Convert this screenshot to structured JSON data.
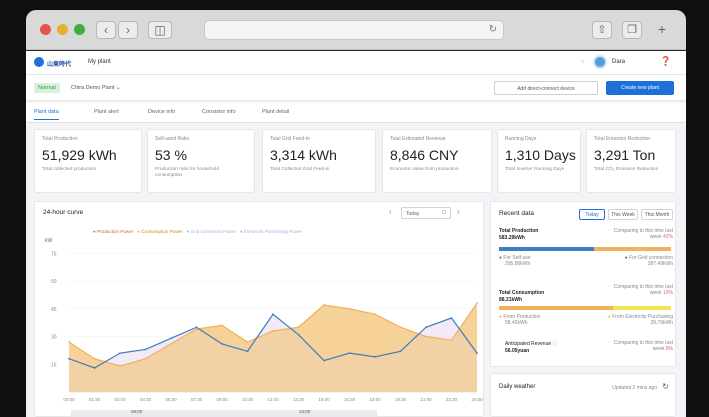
{
  "browser": {
    "colors": {
      "close": "#e5534b",
      "minimize": "#e8b030",
      "maximize": "#3fae3e"
    }
  },
  "header": {
    "logo_text": "山東時代",
    "plant_link": "My plant",
    "user_name": "Dara"
  },
  "subheader": {
    "status_badge": "Normal",
    "plant_name": "Chira Demo Plant",
    "add_device_button": "Add direct-connect device",
    "create_plant_button": "Create new plant"
  },
  "tabs": [
    "Plant data",
    "Plant alert",
    "Device info",
    "Consistor info",
    "Plant detail"
  ],
  "kpis": [
    {
      "label": "Total Production",
      "value": "51,929 kWh",
      "desc": "Total collected production"
    },
    {
      "label": "Self-used Ratio",
      "value": "53 %",
      "desc": "Production ratio for household consumption"
    },
    {
      "label": "Total Grid Feed-in",
      "value": "3,314 kWh",
      "desc": "Total Collected Grid Feed-in"
    },
    {
      "label": "Total Estimated Revenue",
      "value": "8,846 CNY",
      "desc": "Economic value from production"
    },
    {
      "label": "Running Days",
      "value": "1,310 Days",
      "desc": "Total Inverter Running Days"
    },
    {
      "label": "Total Emission Reduction",
      "value": "3,291 Ton",
      "desc": "Total CO₂ Emission Reduction"
    }
  ],
  "curve": {
    "title": "24-hour curve",
    "today_button": "Today",
    "unit_label": "kW",
    "legend": [
      "Production Power",
      "Consumption Power",
      "Grid connected Power",
      "Electricity Purchasing Power"
    ]
  },
  "chart_data": {
    "type": "area",
    "x": [
      "00:00",
      "01:30",
      "03:00",
      "04:30",
      "06:00",
      "07:30",
      "09:00",
      "10:30",
      "12:00",
      "13:30",
      "15:00",
      "16:30",
      "18:00",
      "19:30",
      "21:00",
      "22:30",
      "24:00"
    ],
    "series": [
      {
        "name": "Production Power",
        "color": "#3a7fc1",
        "values": [
          18,
          13,
          21,
          23,
          29,
          35,
          26,
          22,
          42,
          31,
          17,
          21,
          19,
          22,
          35,
          40,
          21
        ]
      },
      {
        "name": "Consumption Power",
        "color": "#f2b15a",
        "values": [
          27,
          18,
          14,
          18,
          26,
          34,
          36,
          27,
          33,
          35,
          47,
          45,
          42,
          35,
          30,
          28,
          48
        ]
      }
    ],
    "ylim": [
      0,
      80
    ],
    "yticks": [
      "75",
      "50",
      "45",
      "30",
      "15"
    ],
    "grid": true,
    "legend_position": "top"
  },
  "recent": {
    "title": "Recent data",
    "periods": [
      "Today",
      "This Week",
      "This Month"
    ],
    "production": {
      "label": "Total Production",
      "value": "583.29kWh",
      "compare": "Comparing to this time last week",
      "change": "42%"
    },
    "prod_items": [
      {
        "label": "For Self-use",
        "value": "295.80kWh"
      },
      {
        "label": "For Grid connection",
        "value": "287.49kWh"
      }
    ],
    "consumption": {
      "label": "Total Consumption",
      "value": "88.21kWh",
      "compare": "Comparing to this time last week",
      "change": "10%"
    },
    "cons_items": [
      {
        "label": "From Production",
        "value": "58.42kWh"
      },
      {
        "label": "From Electricity Purchasing",
        "value": "29.79kWh"
      }
    ],
    "revenue": {
      "label": "Anticipated Revenue",
      "value": "56.05yuan",
      "compare": "Comparing to this time last week",
      "change": "9%"
    }
  },
  "weather": {
    "title": "Daily weather",
    "updated": "Updated 2 mins ago"
  },
  "minimap": {
    "start": "08:00",
    "end": "13:00"
  }
}
